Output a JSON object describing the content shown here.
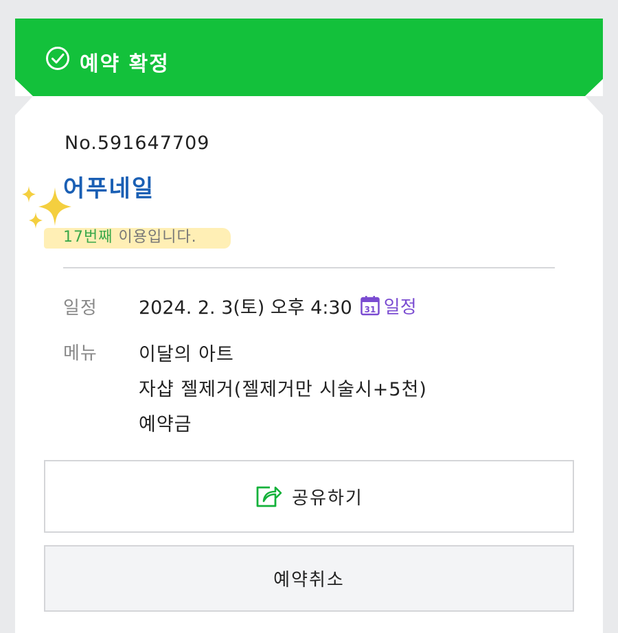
{
  "header": {
    "title": "예약 확정",
    "icon": "check-circle-icon",
    "accent_color": "#13c13b"
  },
  "booking": {
    "number": "No.591647709",
    "shop_name": "어푸네일",
    "usage_count": "17번째",
    "usage_suffix": " 이용입니다."
  },
  "details": {
    "schedule_label": "일정",
    "schedule_value": "2024. 2. 3(토) 오후 4:30",
    "calendar_icon_day": "31",
    "calendar_link": "일정",
    "menu_label": "메뉴",
    "menu_items": [
      "이달의 아트",
      "자샵 젤제거(젤제거만 시술시+5천)",
      "예약금"
    ]
  },
  "actions": {
    "share_label": "공유하기",
    "cancel_label": "예약취소"
  }
}
